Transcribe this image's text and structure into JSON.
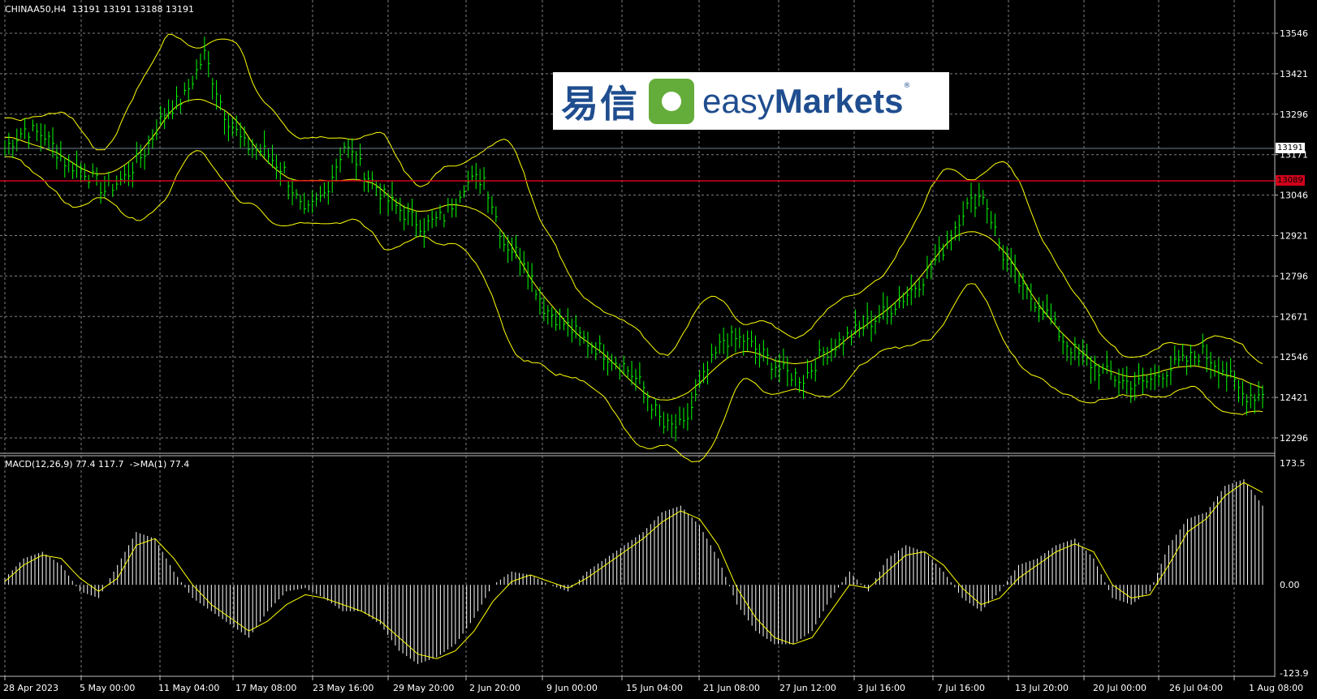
{
  "header": {
    "symbol_info": "CHINAA50,H4  13191 13191 13188 13191",
    "indicator_info": "MACD(12,26,9) 77.4 117.7  ->MA(1) 77.4"
  },
  "logo": {
    "cn_text": "易信",
    "en_regular": "easy",
    "en_bold": "Markets",
    "reg_mark": "®"
  },
  "price_axis": {
    "labels": [
      "13546",
      "13421",
      "13296",
      "13171",
      "13046",
      "12921",
      "12796",
      "12671",
      "12546",
      "12421",
      "12296"
    ],
    "current_price": "13191",
    "current_color": "#ffffff",
    "line_price": "13089",
    "line_color": "#d0021b"
  },
  "macd_axis": {
    "labels": [
      "173.5",
      "0.00",
      "-123.9"
    ]
  },
  "time_axis": {
    "labels": [
      "28 Apr 2023",
      "5 May 00:00",
      "11 May 04:00",
      "17 May 08:00",
      "23 May 16:00",
      "29 May 20:00",
      "2 Jun 20:00",
      "9 Jun 00:00",
      "15 Jun 04:00",
      "21 Jun 08:00",
      "27 Jun 12:00",
      "3 Jul 16:00",
      "7 Jul 16:00",
      "13 Jul 20:00",
      "20 Jul 00:00",
      "26 Jul 04:00",
      "1 Aug 08:00"
    ]
  },
  "colors": {
    "candles": "#00ff00",
    "bands": "#ffff00",
    "histogram": "#ffffff",
    "signal": "#ffff00",
    "grid": "#808080"
  },
  "chart_data": [
    {
      "type": "line",
      "title": "CHINAA50,H4",
      "series": [
        {
          "name": "CHINAA50",
          "x": [
            0,
            5,
            10,
            15,
            20,
            25,
            30,
            35,
            40,
            45,
            50,
            55,
            60,
            65,
            70,
            75,
            80,
            85,
            90,
            95,
            100,
            105,
            110,
            115,
            120,
            125,
            130,
            135,
            140,
            145,
            150,
            155,
            160,
            165,
            170,
            175,
            180,
            185,
            190,
            195,
            200,
            205,
            210,
            215,
            220,
            225,
            230,
            235,
            240,
            245,
            250,
            255,
            260,
            265,
            270,
            275,
            280,
            285,
            290,
            295,
            300,
            305,
            310,
            315
          ],
          "values": [
            13191,
            13250,
            13230,
            13150,
            13120,
            13060,
            13100,
            13180,
            13300,
            13350,
            13480,
            13300,
            13200,
            13180,
            13120,
            12980,
            13050,
            13200,
            13120,
            13040,
            12990,
            12950,
            12980,
            13080,
            13100,
            12900,
            12850,
            12700,
            12650,
            12600,
            12560,
            12520,
            12450,
            12330,
            12330,
            12480,
            12600,
            12600,
            12550,
            12500,
            12480,
            12560,
            12600,
            12640,
            12680,
            12730,
            12790,
            12880,
            13000,
            13050,
            12860,
            12750,
            12700,
            12600,
            12540,
            12500,
            12470,
            12460,
            12500,
            12530,
            12560,
            12510,
            12430,
            12430
          ]
        }
      ],
      "ylim": [
        12296,
        13546
      ]
    },
    {
      "type": "bar",
      "title": "MACD(12,26,9)",
      "series": [
        {
          "name": "MACD",
          "values": [
            10,
            40,
            50,
            30,
            -10,
            -20,
            30,
            80,
            70,
            20,
            -20,
            -40,
            -60,
            -80,
            -40,
            -10,
            -5,
            -20,
            -40,
            -40,
            -60,
            -100,
            -120,
            -110,
            -90,
            -50,
            0,
            20,
            15,
            0,
            -10,
            20,
            40,
            60,
            80,
            110,
            120,
            90,
            40,
            -30,
            -70,
            -90,
            -90,
            -70,
            -20,
            20,
            -10,
            40,
            60,
            50,
            20,
            -20,
            -40,
            -10,
            30,
            40,
            60,
            70,
            40,
            -20,
            -30,
            -10,
            60,
            100,
            110,
            150,
            160,
            120
          ]
        },
        {
          "name": "MA(1)",
          "values": [
            5,
            30,
            45,
            40,
            10,
            -10,
            10,
            60,
            70,
            40,
            0,
            -30,
            -50,
            -70,
            -55,
            -30,
            -15,
            -20,
            -30,
            -40,
            -55,
            -80,
            -105,
            -112,
            -100,
            -70,
            -25,
            5,
            15,
            5,
            -5,
            10,
            30,
            50,
            70,
            95,
            112,
            100,
            60,
            -5,
            -50,
            -80,
            -90,
            -80,
            -40,
            0,
            -5,
            20,
            45,
            50,
            30,
            -5,
            -30,
            -20,
            10,
            30,
            50,
            62,
            50,
            0,
            -20,
            -15,
            30,
            80,
            100,
            135,
            155,
            140
          ]
        }
      ],
      "ylim": [
        -123.9,
        173.5
      ]
    }
  ]
}
